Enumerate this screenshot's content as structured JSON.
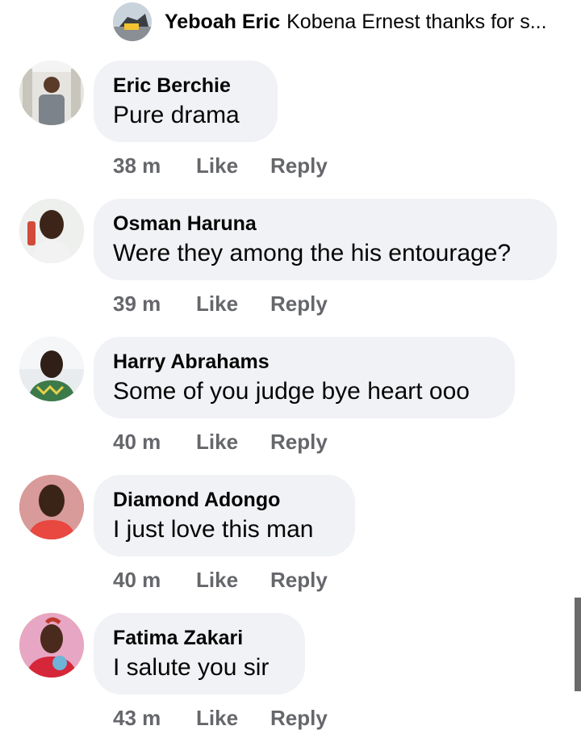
{
  "reply_preview": {
    "name": "Yeboah Eric",
    "message": "Kobena Ernest thanks for s..."
  },
  "comments": [
    {
      "author": "Eric Berchie",
      "text": "Pure drama",
      "time": "38 m",
      "like": "Like",
      "reply": "Reply"
    },
    {
      "author": "Osman Haruna",
      "text": "Were they among the his entourage?",
      "time": "39 m",
      "like": "Like",
      "reply": "Reply"
    },
    {
      "author": "Harry Abrahams",
      "text": "Some of you judge bye heart ooo",
      "time": "40 m",
      "like": "Like",
      "reply": "Reply"
    },
    {
      "author": "Diamond Adongo",
      "text": "I just love this man",
      "time": "40 m",
      "like": "Like",
      "reply": "Reply"
    },
    {
      "author": "Fatima Zakari",
      "text": "I salute you sir",
      "time": "43 m",
      "like": "Like",
      "reply": "Reply"
    }
  ],
  "colors": {
    "bubble": "#f0f2f5",
    "action_text": "#65676b",
    "text": "#050505"
  }
}
